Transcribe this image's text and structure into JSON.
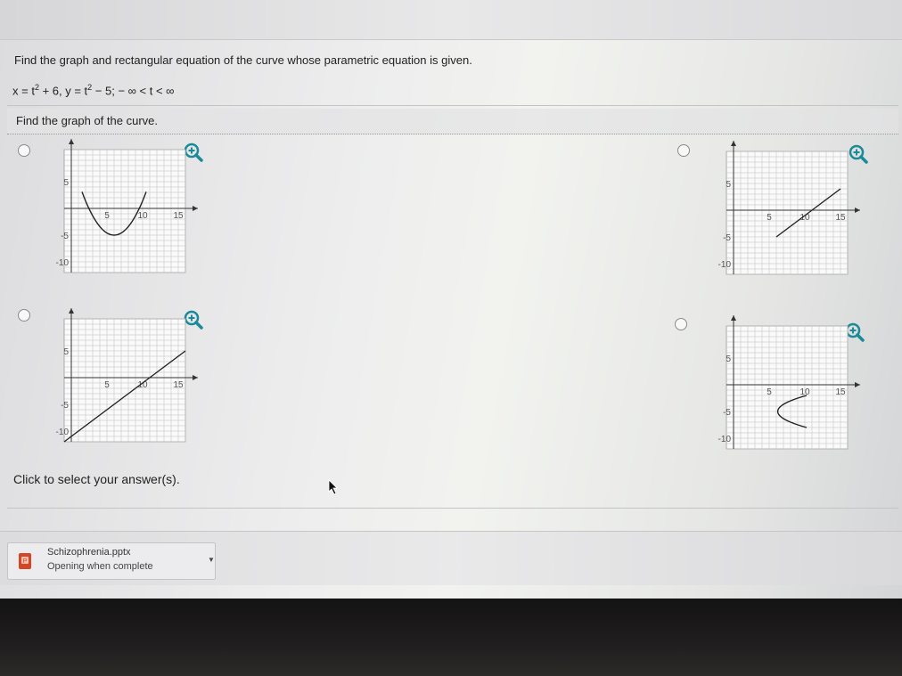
{
  "question": {
    "prompt": "Find the graph and rectangular equation of the curve whose parametric equation is given.",
    "equation": {
      "x_lhs": "x = t",
      "x_exp": "2",
      "x_rhs": " + 6,  y = t",
      "y_exp": "2",
      "y_rhs": " − 5;  − ∞ < t < ∞"
    },
    "instruction": "Find the graph of the curve.",
    "click_text": "Click to select your answer(s)."
  },
  "options": [
    {
      "id": "A",
      "curve": "upward parabola",
      "selected": false,
      "ticks": {
        "x": [
          "5",
          "10",
          "15"
        ],
        "y": [
          "5",
          "-5",
          "-10"
        ]
      }
    },
    {
      "id": "B",
      "curve": "line segment",
      "selected": false,
      "ticks": {
        "x": [
          "5",
          "10",
          "15"
        ],
        "y": [
          "5",
          "-5",
          "-10"
        ]
      }
    },
    {
      "id": "C",
      "curve": "full line",
      "selected": false,
      "ticks": {
        "x": [
          "5",
          "10",
          "15"
        ],
        "y": [
          "5",
          "-5",
          "-10"
        ]
      }
    },
    {
      "id": "D",
      "curve": "rightward parabola",
      "selected": false,
      "ticks": {
        "x": [
          "5",
          "10",
          "15"
        ],
        "y": [
          "5",
          "-5",
          "-10"
        ]
      }
    }
  ],
  "icons": {
    "zoom": "zoom-in-icon",
    "radio": "radio-icon",
    "file": "pptx-file-icon",
    "cursor": "mouse-cursor-icon"
  },
  "colors": {
    "accent": "#1a8a99",
    "curve": "#222222",
    "grid": "#bdbdbd"
  },
  "download": {
    "file_name": "Schizophrenia.pptx",
    "status": "Opening when complete"
  }
}
